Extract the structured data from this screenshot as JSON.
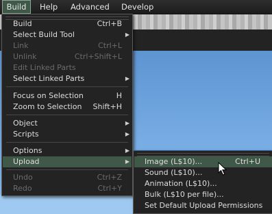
{
  "menubar": {
    "items": [
      {
        "label": "Build"
      },
      {
        "label": "Help"
      },
      {
        "label": "Advanced"
      },
      {
        "label": "Develop"
      }
    ]
  },
  "build_menu": {
    "items": [
      {
        "label": "Build",
        "shortcut": "Ctrl+B",
        "disabled": false
      },
      {
        "label": "Select Build Tool",
        "submenu": true
      },
      {
        "label": "Link",
        "shortcut": "Ctrl+L",
        "disabled": true
      },
      {
        "label": "Unlink",
        "shortcut": "Ctrl+Shift+L",
        "disabled": true
      },
      {
        "label": "Edit Linked Parts",
        "disabled": true
      },
      {
        "label": "Select Linked Parts",
        "submenu": true
      },
      {
        "label": "Focus on Selection",
        "shortcut": "H"
      },
      {
        "label": "Zoom to Selection",
        "shortcut": "Shift+H"
      },
      {
        "label": "Object",
        "submenu": true
      },
      {
        "label": "Scripts",
        "submenu": true
      },
      {
        "label": "Options",
        "submenu": true
      },
      {
        "label": "Upload",
        "submenu": true,
        "highlighted": true
      },
      {
        "label": "Undo",
        "shortcut": "Ctrl+Z",
        "disabled": true
      },
      {
        "label": "Redo",
        "shortcut": "Ctrl+Y",
        "disabled": true
      }
    ]
  },
  "upload_menu": {
    "items": [
      {
        "label": "Image (L$10)...",
        "shortcut": "Ctrl+U",
        "highlighted": true
      },
      {
        "label": "Sound (L$10)..."
      },
      {
        "label": "Animation (L$10)..."
      },
      {
        "label": "Bulk (L$10 per file)..."
      },
      {
        "label": "Set Default Upload Permissions"
      }
    ]
  },
  "colors": {
    "highlight": "#3f5848",
    "menu_bg": "#232323",
    "text": "#dedede",
    "disabled_text": "#6b6b6b"
  },
  "icons": {
    "submenu_arrow": "▶",
    "cursor": "mouse-pointer-icon"
  }
}
